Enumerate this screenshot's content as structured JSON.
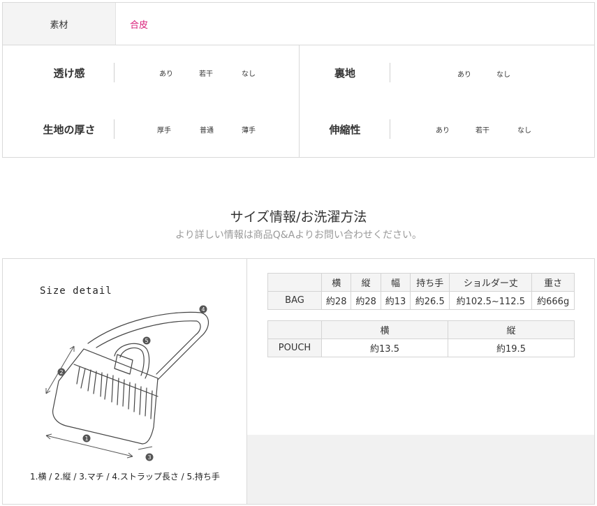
{
  "material": {
    "label": "素材",
    "value": "合皮"
  },
  "properties": {
    "transparency": {
      "label": "透け感",
      "options": [
        "あり",
        "若干",
        "なし"
      ]
    },
    "lining": {
      "label": "裏地",
      "options": [
        "あり",
        "なし"
      ]
    },
    "thickness": {
      "label": "生地の厚さ",
      "options": [
        "厚手",
        "普通",
        "薄手"
      ]
    },
    "stretch": {
      "label": "伸縮性",
      "options": [
        "あり",
        "若干",
        "なし"
      ]
    }
  },
  "section": {
    "title": "サイズ情報/お洗濯方法",
    "subtitle": "より詳しい情報は商品Q&Aよりお問い合わせください。"
  },
  "size_detail": {
    "title": "Size detail",
    "markers": [
      "1",
      "2",
      "3",
      "4",
      "5"
    ],
    "caption": "1.横 / 2.縦 / 3.マチ / 4.ストラップ長さ / 5.持ち手"
  },
  "bag_table": {
    "headers": [
      "横",
      "縦",
      "幅",
      "持ち手",
      "ショルダー丈",
      "重さ"
    ],
    "row_label": "BAG",
    "values": [
      "約28",
      "約28",
      "約13",
      "約26.5",
      "約102.5~112.5",
      "約666g"
    ]
  },
  "pouch_table": {
    "headers": [
      "横",
      "縦"
    ],
    "row_label": "POUCH",
    "values": [
      "約13.5",
      "約19.5"
    ]
  },
  "colors": {
    "accent": "#d81b77",
    "label_bg": "#f4f4f4",
    "border": "#d9d9d9"
  }
}
